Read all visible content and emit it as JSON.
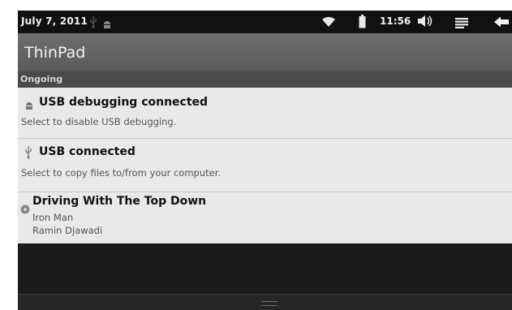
{
  "status_bar": {
    "date": "July 7, 2011",
    "time": "11:56",
    "icons": [
      "usb-icon",
      "android-debug-icon",
      "wifi-icon",
      "battery-icon",
      "volume-icon",
      "menu-icon",
      "back-icon"
    ]
  },
  "app": {
    "title": "ThinPad"
  },
  "section": {
    "label": "Ongoing"
  },
  "notifications": [
    {
      "icon": "android-debug-icon",
      "title": "USB debugging connected",
      "subtitle": "Select to disable USB debugging."
    },
    {
      "icon": "usb-icon",
      "title": "USB connected",
      "subtitle": "Select to copy files to/from your computer."
    },
    {
      "icon": "music-playing-icon",
      "title": "Driving With The Top Down",
      "line1": "Iron Man",
      "line2": "Ramin Djawadi"
    }
  ],
  "colors": {
    "status_bar": "#111111",
    "title_bar": "#666666",
    "notification_bg": "#e9e9e9",
    "panel_bg": "#1d1d1d"
  }
}
